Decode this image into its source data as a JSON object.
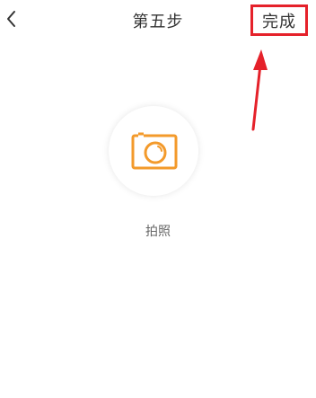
{
  "header": {
    "back_icon": "chevron-left-icon",
    "title": "第五步",
    "done_label": "完成"
  },
  "main": {
    "camera_icon": "camera-icon",
    "camera_label": "拍照"
  },
  "annotation": {
    "highlight_color": "#e5212a",
    "arrow_icon": "arrow-up-icon"
  },
  "colors": {
    "accent": "#f39a2b",
    "text": "#333333"
  }
}
